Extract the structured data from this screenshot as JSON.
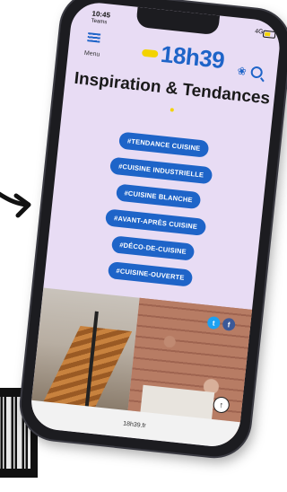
{
  "status": {
    "time": "10:45",
    "carrier": "Teams",
    "network": "4G"
  },
  "header": {
    "menu_label": "Menu",
    "logo_text": "18h39"
  },
  "page": {
    "title": "Inspiration & Tendances"
  },
  "tags": [
    "#TENDANCE CUISINE",
    "#CUISINE INDUSTRIELLE",
    "#CUISINE BLANCHE",
    "#AVANT-APRÈS CUISINE",
    "#DÉCO-DE-CUISINE",
    "#CUISINE-OUVERTE"
  ],
  "browser": {
    "url": "18h39.fr"
  },
  "colors": {
    "brand_blue": "#1e64c8",
    "brand_yellow": "#f3d300",
    "screen_bg": "#e8dcf4"
  },
  "icons": [
    "hamburger-icon",
    "brain-icon",
    "search-icon",
    "twitter-icon",
    "facebook-icon",
    "arrow-up-icon"
  ]
}
